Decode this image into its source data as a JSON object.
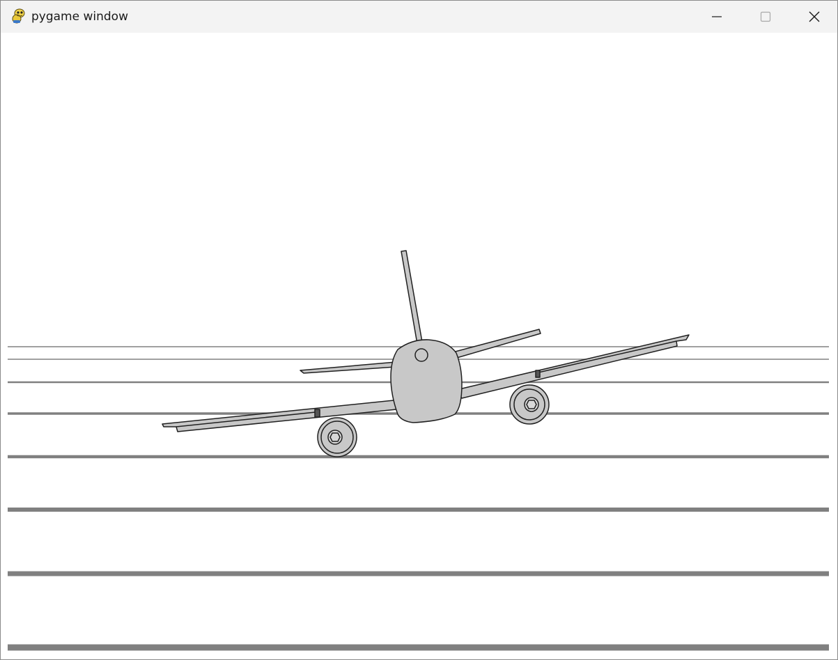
{
  "window": {
    "title": "pygame window",
    "icon": "pygame-snake-icon",
    "controls": [
      "minimize-icon",
      "maximize-icon",
      "close-icon"
    ]
  },
  "scene": {
    "description_colors": {
      "background": "#ffffff",
      "runway_line": "#808080",
      "plane_fill": "#c8c8c8",
      "plane_outline": "#202020"
    }
  }
}
